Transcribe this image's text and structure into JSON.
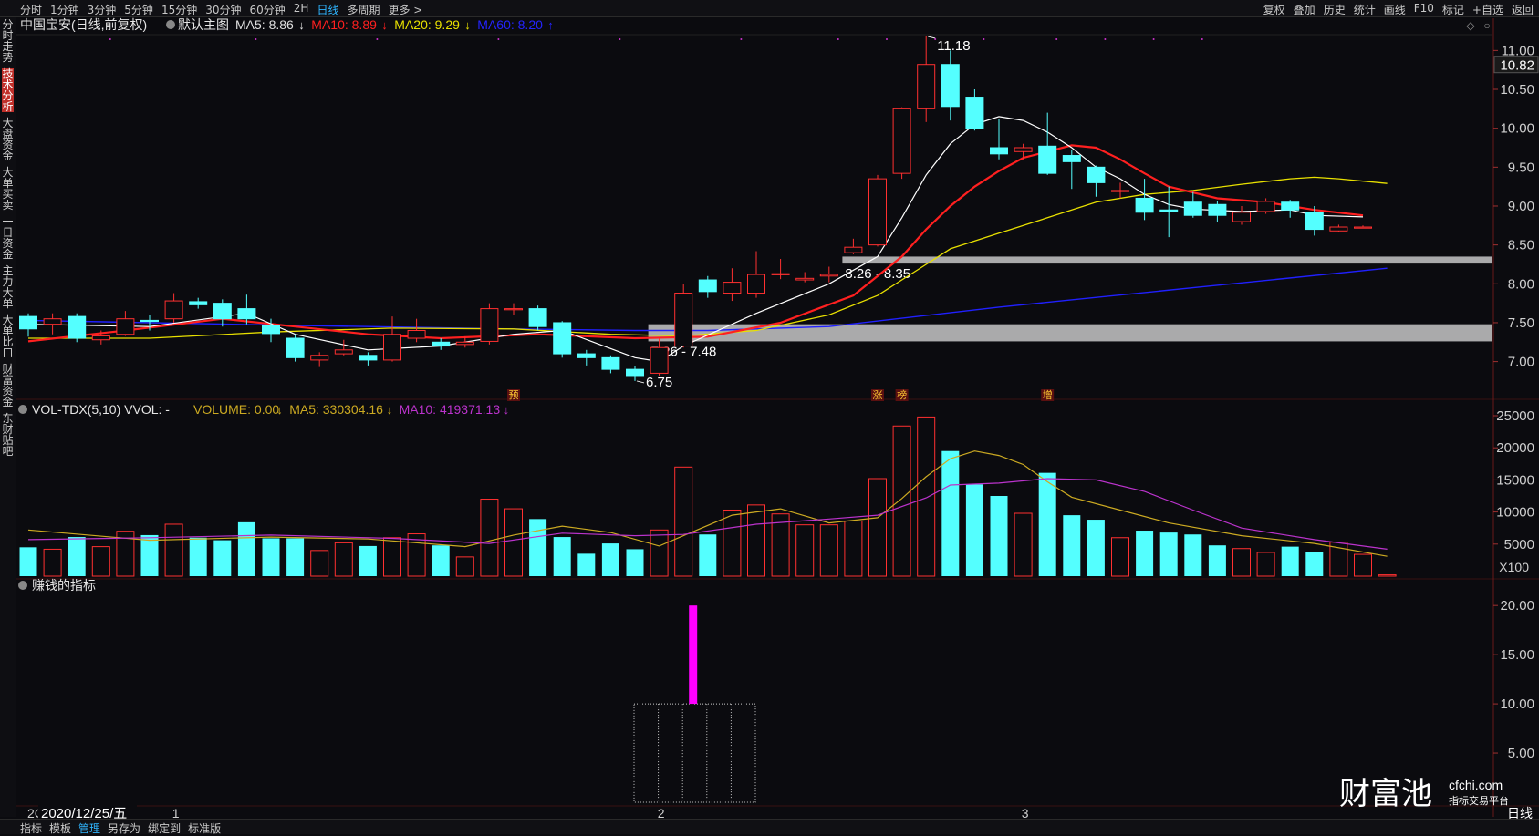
{
  "toolbar": {
    "periods": [
      "分时",
      "1分钟",
      "3分钟",
      "5分钟",
      "15分钟",
      "30分钟",
      "60分钟",
      "2H",
      "日线",
      "多周期",
      "更多 >"
    ],
    "selected_period": "日线",
    "right_tools": [
      "复权",
      "叠加",
      "历史",
      "统计",
      "画线",
      "F10",
      "标记",
      "+自选",
      "返回"
    ]
  },
  "left_tabs": [
    "分时走势",
    "技术分析",
    "大盘资金",
    "大单买卖",
    "一日资金",
    "主力大单",
    "大单比口",
    "财富资金",
    "东财贴吧"
  ],
  "left_tab_active": "技术分析",
  "bottom_tabs": [
    "指标",
    "模板",
    "管理",
    "另存为",
    "绑定到",
    "标准版"
  ],
  "bottom_tab_selected": "管理",
  "brand": {
    "name": "财富池",
    "domain": "cfchi.com",
    "tagline": "指标交易平台"
  },
  "colors": {
    "bg": "#0b0b0f",
    "up": "#ff3030",
    "down": "#54ffff",
    "ma5": "#ffffff",
    "ma10": "#ff2020",
    "ma20": "#e8e000",
    "ma60": "#2020ff",
    "zone": "#ffffff",
    "indicator": "#ff00ff",
    "vma5": "#ccaa22",
    "vma10": "#bb33cc"
  },
  "chart_data": [
    {
      "type": "candlestick",
      "title": "中国宝安(日线,前复权)",
      "subtitle": "默认主图",
      "legend": [
        {
          "label": "MA5: 8.86",
          "arrow": "↓",
          "color": "#e0e0e0"
        },
        {
          "label": "MA10: 8.89",
          "arrow": "↓",
          "color": "#ff2020"
        },
        {
          "label": "MA20: 9.29",
          "arrow": "↓",
          "color": "#e8e000"
        },
        {
          "label": "MA60: 8.20",
          "arrow": "↑",
          "color": "#2424ff"
        }
      ],
      "y_ticks": [
        "11.00",
        "10.50",
        "10.00",
        "9.50",
        "9.00",
        "8.50",
        "8.00",
        "7.50",
        "7.00"
      ],
      "ylim": [
        6.55,
        11.18
      ],
      "last_price": "10.82",
      "candles": [
        {
          "o": 7.58,
          "c": 7.42,
          "h": 7.62,
          "l": 7.32
        },
        {
          "o": 7.48,
          "c": 7.55,
          "h": 7.62,
          "l": 7.35
        },
        {
          "o": 7.58,
          "c": 7.3,
          "h": 7.62,
          "l": 7.25
        },
        {
          "o": 7.28,
          "c": 7.33,
          "h": 7.4,
          "l": 7.22
        },
        {
          "o": 7.35,
          "c": 7.55,
          "h": 7.65,
          "l": 7.33
        },
        {
          "o": 7.53,
          "c": 7.52,
          "h": 7.6,
          "l": 7.4
        },
        {
          "o": 7.55,
          "c": 7.78,
          "h": 7.88,
          "l": 7.5
        },
        {
          "o": 7.77,
          "c": 7.73,
          "h": 7.82,
          "l": 7.68
        },
        {
          "o": 7.75,
          "c": 7.55,
          "h": 7.8,
          "l": 7.45
        },
        {
          "o": 7.68,
          "c": 7.55,
          "h": 7.86,
          "l": 7.48
        },
        {
          "o": 7.46,
          "c": 7.36,
          "h": 7.55,
          "l": 7.25
        },
        {
          "o": 7.3,
          "c": 7.05,
          "h": 7.35,
          "l": 7.0
        },
        {
          "o": 7.02,
          "c": 7.08,
          "h": 7.12,
          "l": 6.93
        },
        {
          "o": 7.1,
          "c": 7.15,
          "h": 7.28,
          "l": 7.08
        },
        {
          "o": 7.08,
          "c": 7.02,
          "h": 7.12,
          "l": 6.95
        },
        {
          "o": 7.02,
          "c": 7.35,
          "h": 7.58,
          "l": 7.0
        },
        {
          "o": 7.3,
          "c": 7.4,
          "h": 7.55,
          "l": 7.25
        },
        {
          "o": 7.25,
          "c": 7.2,
          "h": 7.3,
          "l": 7.15
        },
        {
          "o": 7.22,
          "c": 7.25,
          "h": 7.32,
          "l": 7.18
        },
        {
          "o": 7.26,
          "c": 7.68,
          "h": 7.75,
          "l": 7.22
        },
        {
          "o": 7.67,
          "c": 7.68,
          "h": 7.75,
          "l": 7.6
        },
        {
          "o": 7.68,
          "c": 7.45,
          "h": 7.72,
          "l": 7.4
        },
        {
          "o": 7.5,
          "c": 7.1,
          "h": 7.52,
          "l": 7.05
        },
        {
          "o": 7.1,
          "c": 7.05,
          "h": 7.15,
          "l": 6.95
        },
        {
          "o": 7.05,
          "c": 6.9,
          "h": 7.08,
          "l": 6.85
        },
        {
          "o": 6.9,
          "c": 6.82,
          "h": 6.94,
          "l": 6.75
        },
        {
          "o": 6.85,
          "c": 7.18,
          "h": 7.3,
          "l": 6.82
        },
        {
          "o": 7.2,
          "c": 7.88,
          "h": 8.0,
          "l": 7.18
        },
        {
          "o": 8.05,
          "c": 7.9,
          "h": 8.1,
          "l": 7.82
        },
        {
          "o": 7.88,
          "c": 8.02,
          "h": 8.2,
          "l": 7.78
        },
        {
          "o": 7.88,
          "c": 8.12,
          "h": 8.42,
          "l": 7.82
        },
        {
          "o": 8.12,
          "c": 8.13,
          "h": 8.32,
          "l": 8.06
        },
        {
          "o": 8.05,
          "c": 8.07,
          "h": 8.15,
          "l": 8.02
        },
        {
          "o": 8.1,
          "c": 8.12,
          "h": 8.22,
          "l": 8.02
        },
        {
          "o": 8.4,
          "c": 8.47,
          "h": 8.58,
          "l": 8.38
        },
        {
          "o": 8.5,
          "c": 9.35,
          "h": 9.4,
          "l": 8.48
        },
        {
          "o": 9.42,
          "c": 10.25,
          "h": 10.27,
          "l": 9.35
        },
        {
          "o": 10.25,
          "c": 10.82,
          "h": 11.18,
          "l": 10.08
        },
        {
          "o": 10.82,
          "c": 10.28,
          "h": 11.0,
          "l": 10.1
        },
        {
          "o": 10.4,
          "c": 10.0,
          "h": 10.5,
          "l": 9.97
        },
        {
          "o": 9.75,
          "c": 9.67,
          "h": 10.12,
          "l": 9.6
        },
        {
          "o": 9.7,
          "c": 9.75,
          "h": 9.8,
          "l": 9.6
        },
        {
          "o": 9.77,
          "c": 9.42,
          "h": 10.2,
          "l": 9.4
        },
        {
          "o": 9.65,
          "c": 9.57,
          "h": 9.72,
          "l": 9.22
        },
        {
          "o": 9.5,
          "c": 9.3,
          "h": 9.52,
          "l": 9.12
        },
        {
          "o": 9.2,
          "c": 9.2,
          "h": 9.3,
          "l": 9.1
        },
        {
          "o": 9.1,
          "c": 8.92,
          "h": 9.35,
          "l": 8.82
        },
        {
          "o": 8.95,
          "c": 8.93,
          "h": 9.25,
          "l": 8.6
        },
        {
          "o": 9.05,
          "c": 8.88,
          "h": 9.18,
          "l": 8.85
        },
        {
          "o": 9.02,
          "c": 8.88,
          "h": 9.06,
          "l": 8.8
        },
        {
          "o": 8.8,
          "c": 8.92,
          "h": 9.0,
          "l": 8.76
        },
        {
          "o": 8.93,
          "c": 9.06,
          "h": 9.1,
          "l": 8.9
        },
        {
          "o": 9.05,
          "c": 8.95,
          "h": 9.08,
          "l": 8.85
        },
        {
          "o": 8.92,
          "c": 8.7,
          "h": 9.0,
          "l": 8.62
        },
        {
          "o": 8.68,
          "c": 8.73,
          "h": 8.76,
          "l": 8.66
        },
        {
          "o": 8.73,
          "c": 8.73,
          "h": 8.75,
          "l": 8.72
        }
      ],
      "ma_lines": {
        "ma5": [
          [
            0,
            7.48
          ],
          [
            5,
            7.45
          ],
          [
            9,
            7.62
          ],
          [
            11,
            7.35
          ],
          [
            14,
            7.15
          ],
          [
            17,
            7.2
          ],
          [
            20,
            7.35
          ],
          [
            22,
            7.4
          ],
          [
            25,
            7.05
          ],
          [
            26,
            7.0
          ],
          [
            27,
            7.2
          ],
          [
            30,
            7.62
          ],
          [
            33,
            8.0
          ],
          [
            35,
            8.35
          ],
          [
            36,
            8.85
          ],
          [
            37,
            9.4
          ],
          [
            38,
            9.8
          ],
          [
            39,
            10.05
          ],
          [
            40,
            10.15
          ],
          [
            41,
            10.1
          ],
          [
            42,
            9.95
          ],
          [
            43,
            9.75
          ],
          [
            44,
            9.5
          ],
          [
            45,
            9.35
          ],
          [
            46,
            9.15
          ],
          [
            47,
            9.02
          ],
          [
            48,
            8.96
          ],
          [
            50,
            8.93
          ],
          [
            52,
            8.95
          ],
          [
            53,
            8.88
          ],
          [
            55,
            8.86
          ]
        ],
        "ma10": [
          [
            0,
            7.26
          ],
          [
            4,
            7.4
          ],
          [
            8,
            7.55
          ],
          [
            11,
            7.45
          ],
          [
            14,
            7.35
          ],
          [
            17,
            7.3
          ],
          [
            21,
            7.35
          ],
          [
            25,
            7.3
          ],
          [
            28,
            7.32
          ],
          [
            31,
            7.5
          ],
          [
            34,
            7.85
          ],
          [
            36,
            8.35
          ],
          [
            37,
            8.7
          ],
          [
            38,
            9.0
          ],
          [
            39,
            9.25
          ],
          [
            40,
            9.45
          ],
          [
            41,
            9.62
          ],
          [
            43,
            9.78
          ],
          [
            44,
            9.75
          ],
          [
            45,
            9.6
          ],
          [
            46,
            9.42
          ],
          [
            47,
            9.25
          ],
          [
            49,
            9.1
          ],
          [
            51,
            9.05
          ],
          [
            53,
            8.95
          ],
          [
            55,
            8.88
          ]
        ],
        "ma20": [
          [
            0,
            7.3
          ],
          [
            5,
            7.3
          ],
          [
            10,
            7.38
          ],
          [
            15,
            7.43
          ],
          [
            20,
            7.42
          ],
          [
            24,
            7.35
          ],
          [
            27,
            7.33
          ],
          [
            30,
            7.4
          ],
          [
            33,
            7.6
          ],
          [
            35,
            7.85
          ],
          [
            37,
            8.25
          ],
          [
            38,
            8.45
          ],
          [
            40,
            8.65
          ],
          [
            42,
            8.85
          ],
          [
            44,
            9.05
          ],
          [
            46,
            9.15
          ],
          [
            48,
            9.2
          ],
          [
            50,
            9.28
          ],
          [
            52,
            9.35
          ],
          [
            53,
            9.37
          ],
          [
            54,
            9.35
          ],
          [
            56,
            9.29
          ]
        ],
        "ma60": [
          [
            0,
            7.53
          ],
          [
            10,
            7.47
          ],
          [
            20,
            7.42
          ],
          [
            25,
            7.4
          ],
          [
            28,
            7.4
          ],
          [
            33,
            7.45
          ],
          [
            40,
            7.7
          ],
          [
            48,
            7.95
          ],
          [
            56,
            8.2
          ]
        ]
      },
      "zones": [
        {
          "label": "8.26 - 8.35",
          "low": 8.26,
          "high": 8.35,
          "start_index": 34
        },
        {
          "label": "7.26 - 7.48",
          "low": 7.26,
          "high": 7.48,
          "start_index": 26
        }
      ],
      "annotations": [
        {
          "text": "11.18",
          "index": 37,
          "price": 11.18
        },
        {
          "text": "6.75",
          "index": 25,
          "price": 6.75
        }
      ],
      "markers": [
        {
          "text": "预",
          "index": 20
        },
        {
          "text": "涨",
          "index": 35
        },
        {
          "text": "榜",
          "index": 36
        },
        {
          "text": "增",
          "index": 42
        }
      ]
    },
    {
      "type": "bar",
      "title": "VOL-TDX(5,10) VVOL: -",
      "legend": [
        {
          "label": "VOLUME: 0.00",
          "arrow": "↓",
          "color": "#ccaa22"
        },
        {
          "label": "MA5: 330304.16",
          "arrow": "↓",
          "color": "#ccaa22"
        },
        {
          "label": "MA10: 419371.13",
          "arrow": "↓",
          "color": "#bb33cc"
        }
      ],
      "unit": "X100",
      "y_ticks": [
        "25000",
        "20000",
        "15000",
        "10000",
        "5000"
      ],
      "ylim": [
        0,
        25000
      ],
      "values": [
        4500,
        4200,
        6100,
        4600,
        7000,
        6400,
        8100,
        6000,
        5600,
        8400,
        5900,
        5900,
        4000,
        5200,
        4700,
        6000,
        6600,
        4800,
        3000,
        12000,
        10500,
        8900,
        6100,
        3500,
        5100,
        4200,
        7200,
        17000,
        6500,
        10300,
        11100,
        9700,
        8000,
        8000,
        8600,
        15200,
        23400,
        24800,
        19500,
        14300,
        12500,
        9800,
        16100,
        9500,
        8800,
        6000,
        7100,
        6800,
        6500,
        4800,
        4300,
        3700,
        4600,
        3800,
        5300,
        3400,
        200
      ],
      "ma5": [
        [
          0,
          7200
        ],
        [
          5,
          5600
        ],
        [
          10,
          6100
        ],
        [
          14,
          5800
        ],
        [
          18,
          4600
        ],
        [
          20,
          6400
        ],
        [
          22,
          7800
        ],
        [
          24,
          6800
        ],
        [
          26,
          4700
        ],
        [
          27,
          6300
        ],
        [
          29,
          9500
        ],
        [
          31,
          10500
        ],
        [
          33,
          8300
        ],
        [
          35,
          9100
        ],
        [
          36,
          12100
        ],
        [
          37,
          15500
        ],
        [
          38,
          18300
        ],
        [
          39,
          19500
        ],
        [
          40,
          18800
        ],
        [
          41,
          17400
        ],
        [
          42,
          14700
        ],
        [
          43,
          12300
        ],
        [
          45,
          10300
        ],
        [
          47,
          8300
        ],
        [
          50,
          6300
        ],
        [
          53,
          5100
        ],
        [
          56,
          3100
        ]
      ],
      "ma10": [
        [
          0,
          5700
        ],
        [
          5,
          6000
        ],
        [
          10,
          6400
        ],
        [
          15,
          5900
        ],
        [
          19,
          5100
        ],
        [
          22,
          6700
        ],
        [
          25,
          6300
        ],
        [
          27,
          6500
        ],
        [
          30,
          8100
        ],
        [
          33,
          8900
        ],
        [
          35,
          9500
        ],
        [
          37,
          12200
        ],
        [
          38,
          14200
        ],
        [
          40,
          14500
        ],
        [
          42,
          15200
        ],
        [
          44,
          15000
        ],
        [
          46,
          13200
        ],
        [
          48,
          10300
        ],
        [
          50,
          7500
        ],
        [
          53,
          5700
        ],
        [
          56,
          4200
        ]
      ]
    },
    {
      "type": "bar",
      "title": "赚钱的指标",
      "y_ticks": [
        "20.00",
        "15.00",
        "10.00",
        "5.00"
      ],
      "ylim": [
        0,
        21.5
      ],
      "values": [
        {
          "index": 27,
          "value": 20
        }
      ],
      "box": {
        "start_index": 25,
        "end_index": 30,
        "low": 0,
        "high": 10
      }
    }
  ],
  "x_axis": {
    "date_label": "2020/12/25/五",
    "date_prefix": "2C",
    "months": [
      {
        "text": "1",
        "index": 6
      },
      {
        "text": "2",
        "index": 26
      },
      {
        "text": "3",
        "index": 41
      }
    ],
    "period_label": "日线"
  }
}
